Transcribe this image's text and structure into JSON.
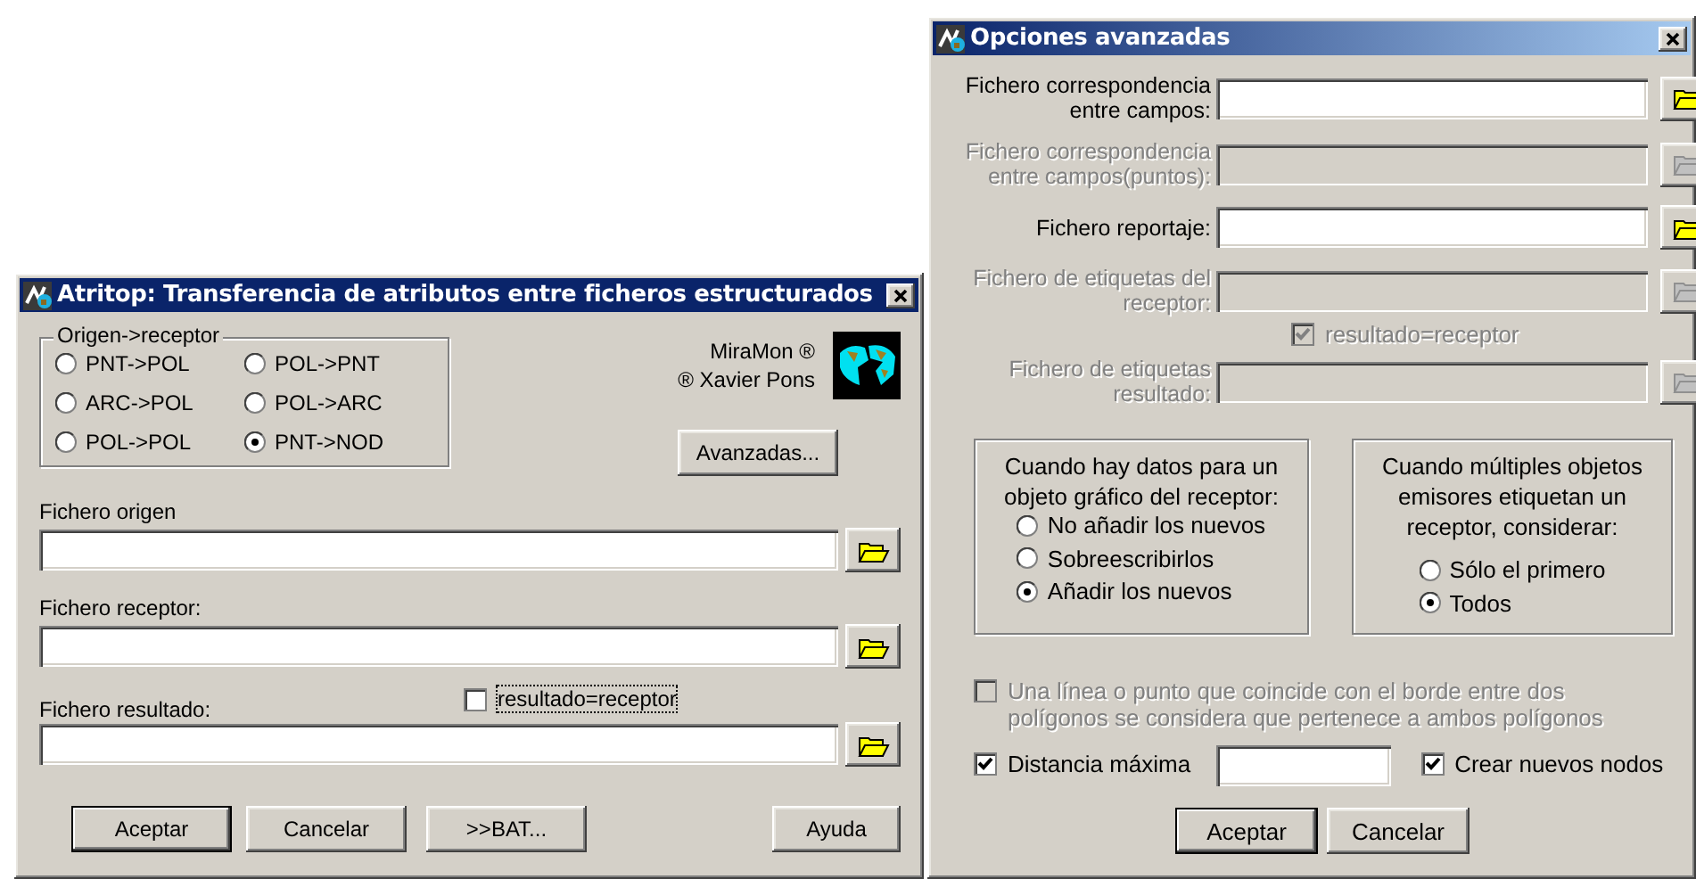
{
  "atritop_dialog": {
    "title": "Atritop: Transferencia de atributos entre ficheros estructurados",
    "source_receptor": {
      "label": "Origen->receptor",
      "options": [
        {
          "label": "PNT->POL",
          "selected": false
        },
        {
          "label": "POL->PNT",
          "selected": false
        },
        {
          "label": "ARC->POL",
          "selected": false
        },
        {
          "label": "POL->ARC",
          "selected": false
        },
        {
          "label": "POL->POL",
          "selected": false
        },
        {
          "label": "PNT->NOD",
          "selected": true
        }
      ]
    },
    "credits": [
      "MiraMon ®",
      "® Xavier Pons"
    ],
    "advanced_button": "Avanzadas...",
    "fields": [
      {
        "label": "Fichero origen"
      },
      {
        "label": "Fichero receptor:"
      },
      {
        "label": "Fichero resultado:",
        "checkbox": {
          "label": "resultado=receptor",
          "checked": false,
          "focused": true
        }
      }
    ],
    "buttons": [
      {
        "label": "Aceptar",
        "default": true
      },
      {
        "label": "Cancelar",
        "default": false
      },
      {
        "label": ">>BAT...",
        "default": false
      },
      {
        "label": "Ayuda",
        "default": false
      }
    ]
  },
  "advanced_dialog": {
    "title": "Opciones avanzadas",
    "fields": [
      {
        "label_lines": [
          "Fichero correspondencia",
          "entre campos:"
        ],
        "disabled": false
      },
      {
        "label_lines": [
          "Fichero correspondencia",
          "entre campos(puntos):"
        ],
        "disabled": true
      },
      {
        "label_lines": [
          "Fichero reportaje:"
        ],
        "disabled": false
      },
      {
        "label_lines": [
          "Fichero de etiquetas del",
          "receptor:"
        ],
        "disabled": true,
        "checkbox": {
          "label": "resultado=receptor",
          "checked": true,
          "disabled": true
        }
      },
      {
        "label_lines": [
          "Fichero de etiquetas",
          "resultado:"
        ],
        "disabled": true
      }
    ],
    "groups": [
      {
        "heading_lines": [
          "Cuando hay datos para un",
          "objeto gráfico del receptor:"
        ],
        "options": [
          {
            "label": "No añadir los nuevos",
            "selected": false
          },
          {
            "label": "Sobreescribirlos",
            "selected": false
          },
          {
            "label": "Añadir los nuevos",
            "selected": true
          }
        ]
      },
      {
        "heading_lines": [
          "Cuando múltiples objetos",
          "emisores etiquetan un",
          "receptor, considerar:"
        ],
        "options": [
          {
            "label": "Sólo el primero",
            "selected": false
          },
          {
            "label": "Todos",
            "selected": true
          }
        ]
      }
    ],
    "border_option": {
      "lines": [
        "Una línea o punto que coincide con el borde entre dos",
        "polígonos se considera que pertenece a ambos polígonos"
      ],
      "checked": false,
      "disabled": true
    },
    "max_distance": {
      "label": "Distancia máxima",
      "checked": true
    },
    "create_nodes": {
      "label": "Crear nuevos nodos",
      "checked": true
    },
    "buttons": [
      {
        "label": "Aceptar",
        "default": true
      },
      {
        "label": "Cancelar",
        "default": false
      }
    ]
  }
}
